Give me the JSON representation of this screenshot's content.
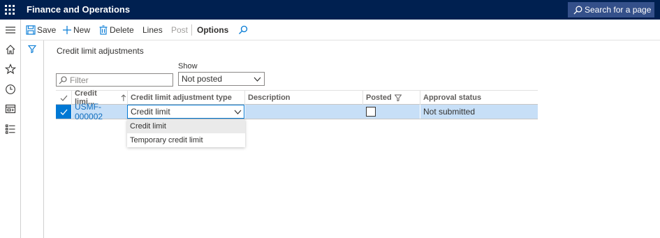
{
  "header": {
    "app_title": "Finance and Operations",
    "search_label": "Search for a page"
  },
  "toolbar": {
    "save_label": "Save",
    "new_label": "New",
    "delete_label": "Delete",
    "lines_label": "Lines",
    "post_label": "Post",
    "options_label": "Options"
  },
  "page": {
    "title": "Credit limit adjustments",
    "filter_placeholder": "Filter",
    "show_label": "Show",
    "show_value": "Not posted"
  },
  "grid": {
    "columns": [
      "Credit limi...",
      "Credit limit adjustment type",
      "Description",
      "Posted",
      "Approval status"
    ],
    "rows": [
      {
        "id": "USMF-000002",
        "adjustment_type": "Credit limit",
        "description": "",
        "posted": false,
        "approval_status": "Not submitted"
      }
    ]
  },
  "dropdown": {
    "options": [
      "Credit limit",
      "Temporary credit limit"
    ],
    "selected": "Credit limit"
  },
  "colors": {
    "topbar": "#002050",
    "accent": "#0078d4",
    "row_selected": "#c7dff7"
  },
  "icons": [
    "waffle-icon",
    "search-icon",
    "hamburger-icon",
    "home-icon",
    "star-icon",
    "clock-icon",
    "workspace-icon",
    "list-icon",
    "save-icon",
    "plus-icon",
    "trash-icon",
    "filter-icon",
    "sort-up-icon",
    "chevron-down-icon",
    "checkmark-icon"
  ]
}
